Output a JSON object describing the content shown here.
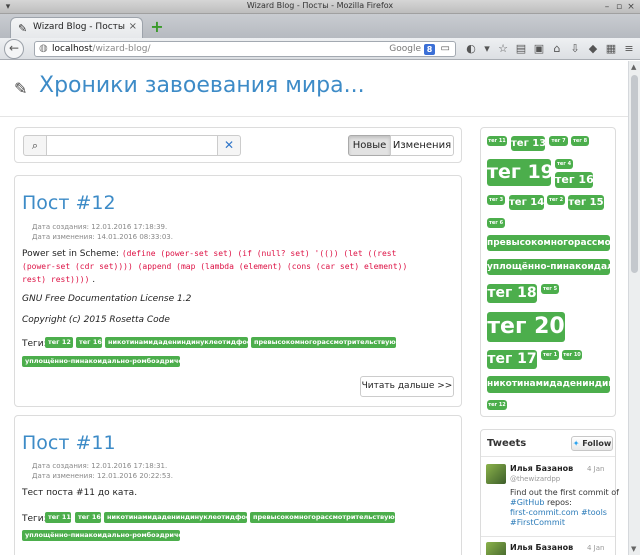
{
  "window": {
    "title": "Wizard Blog - Посты - Mozilla Firefox",
    "tab_label": "Wizard Blog - Посты"
  },
  "navbar": {
    "url_host": "localhost",
    "url_path": "/wizard-blog/",
    "search_engine": "Google"
  },
  "header": {
    "title": "Хроники завоевания мира..."
  },
  "search": {
    "placeholder": "",
    "sort_new": "Новые",
    "sort_changed": "Изменения"
  },
  "posts": [
    {
      "title": "Пост #12",
      "created": "Дата создания: 12.01.2016 17:18:39.",
      "modified": "Дата изменения: 14.01.2016 08:33:03.",
      "intro": "Power set in Scheme: ",
      "code_line1": "(define (power-set set) (if (null? set) '(()) (let ((rest",
      "code_line2": "(power-set (cdr set)))) (append (map (lambda (element) (cons (car set) element))",
      "code_line3": "rest) rest))))",
      "code_tail": " .",
      "license": "GNU Free Documentation License 1.2",
      "copyright": "Copyright (c) 2015 Rosetta Code",
      "tags_label": "Теги:",
      "tags": [
        "тег 12",
        "тег 16",
        "никотинамидадениндинуклеотидфосфат",
        "превысокомногорассмотрительствующий",
        "уплощённо-пинакоидально-ромбоэдрический"
      ],
      "read_more": "Читать дальше >>"
    },
    {
      "title": "Пост #11",
      "created": "Дата создания: 12.01.2016 17:18:31.",
      "modified": "Дата изменения: 12.01.2016 20:22:53.",
      "body": "Тест поста #11 до ката.",
      "tags_label": "Теги:",
      "tags": [
        "тег 11",
        "тег 16",
        "никотинамидадениндинуклеотидфосфат",
        "превысокомногорассмотрительствующий",
        "уплощённо-пинакоидально-ромбоэдрический"
      ]
    }
  ],
  "tag_cloud": [
    "тег 11",
    "тег 13",
    "тег 7",
    "тег 8",
    "тег 19",
    "тег 4",
    "тег 16",
    "тег 3",
    "тег 14",
    "тег 2",
    "тег 15",
    "тег 6",
    "превысокомногорассмотрительствующий",
    "уплощённо-пинакоидально-ромбоэдрический",
    "тег 18",
    "тег 5",
    "тег 20",
    "тег 17",
    "тег 1",
    "тег 10",
    "никотинамидадениндинуклеотидфосфат",
    "тег 12"
  ],
  "tweets": {
    "heading": "Tweets",
    "follow_label": "Follow",
    "items": [
      {
        "name": "Илья Базанов",
        "date": "4 Jan",
        "handle": "@thewizardpp",
        "line1": "Find out the first commit of",
        "line2_tag": "#GitHub",
        "line2_rest": " repos:",
        "link": "first-commit.com",
        "link_tag": "#tools",
        "line4": "#FirstCommit"
      },
      {
        "name": "Илья Базанов",
        "date": "4 Jan"
      }
    ]
  },
  "colors": {
    "accent": "#3d8bc7",
    "tag_green": "#4cae4c"
  }
}
